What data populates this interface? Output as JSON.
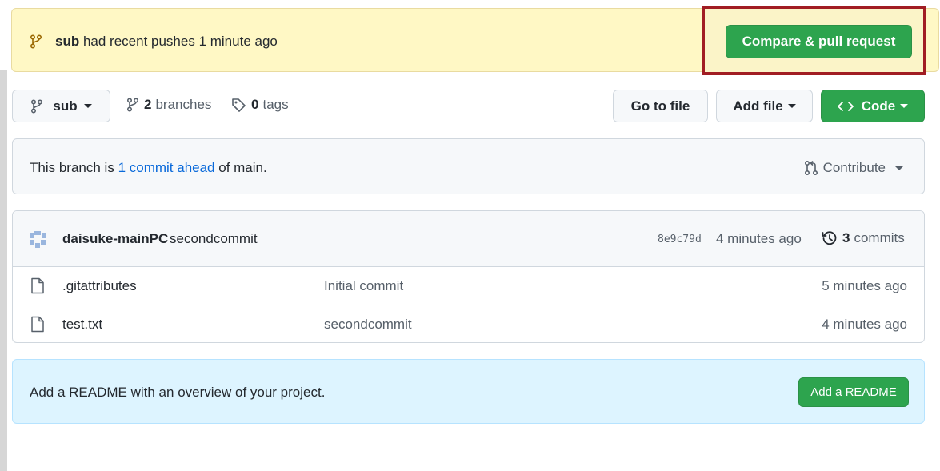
{
  "banner": {
    "branch": "sub",
    "message": "had recent pushes 1 minute ago",
    "compare_label": "Compare & pull request"
  },
  "toolbar": {
    "branch_selector": "sub",
    "branches_count": "2",
    "branches_label": "branches",
    "tags_count": "0",
    "tags_label": "tags",
    "goto_file": "Go to file",
    "add_file": "Add file",
    "code": "Code"
  },
  "ahead": {
    "prefix": "This branch is",
    "link": "1 commit ahead",
    "suffix": "of main.",
    "contribute": "Contribute"
  },
  "latest_commit": {
    "author": "daisuke-mainPC",
    "message": "secondcommit",
    "sha": "8e9c79d",
    "time": "4 minutes ago",
    "count": "3",
    "count_label": "commits"
  },
  "files": [
    {
      "name": ".gitattributes",
      "message": "Initial commit",
      "age": "5 minutes ago"
    },
    {
      "name": "test.txt",
      "message": "secondcommit",
      "age": "4 minutes ago"
    }
  ],
  "readme": {
    "text": "Add a README with an overview of your project.",
    "button": "Add a README"
  },
  "colors": {
    "green": "#2da44e",
    "highlight": "#a11d23",
    "banner_bg": "#fff8c5",
    "link": "#0969da"
  }
}
